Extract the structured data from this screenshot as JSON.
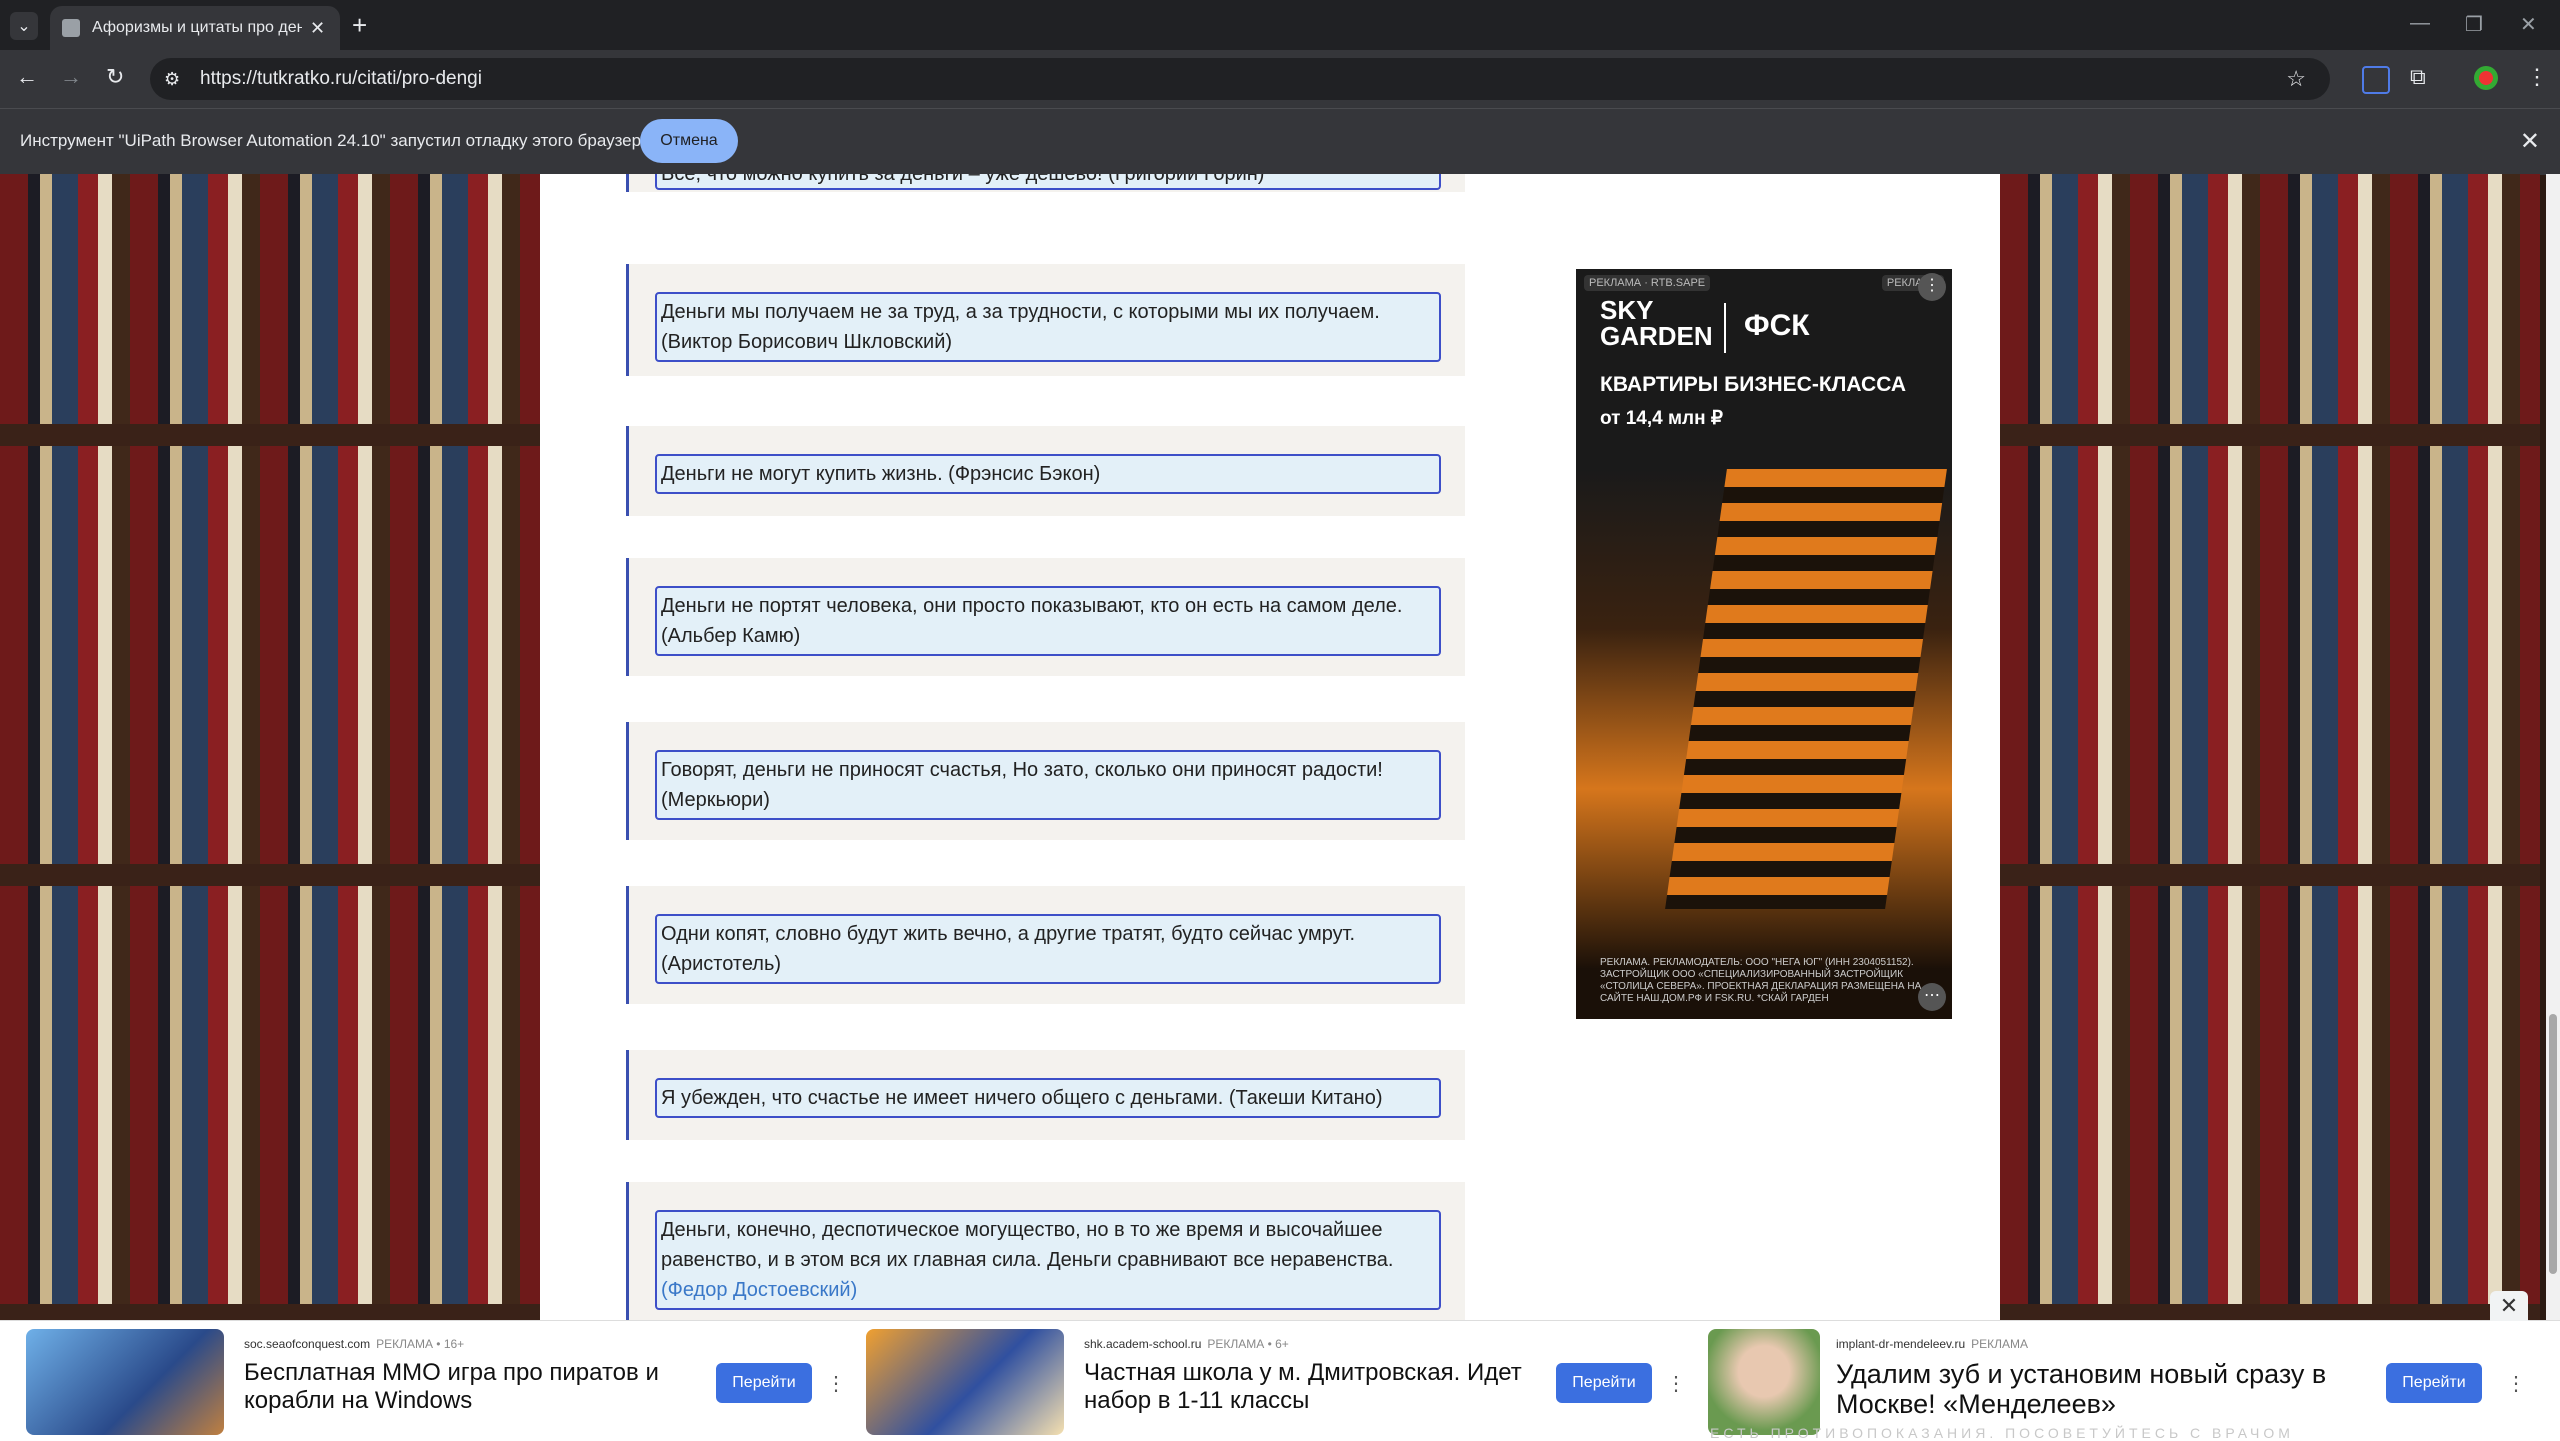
{
  "browser": {
    "tab_title": "Афоризмы и цитаты про день…",
    "url": "https://tutkratko.ru/citati/pro-dengi",
    "infobar_text": "Инструмент \"UiPath Browser Automation 24.10\" запустил отладку этого браузера.",
    "infobar_button": "Отмена"
  },
  "quotes": [
    {
      "text": "Все, что можно купить за деньги – уже дешево! (Григорий Горин)",
      "author_link": ""
    },
    {
      "text": "Деньги мы получаем не за труд, а за трудности, с которыми мы их получаем. (Виктор Борисович Шкловский)",
      "author_link": ""
    },
    {
      "text": "Деньги не могут купить жизнь. (Фрэнсис Бэкон)",
      "author_link": ""
    },
    {
      "text": "Деньги не портят человека, они просто показывают, кто он есть на самом деле. (Альбер Камю)",
      "author_link": ""
    },
    {
      "text": "Говорят, деньги не приносят счастья, Но зато, сколько они приносят радости! (Меркьюри)",
      "author_link": ""
    },
    {
      "text": "Одни копят, словно будут жить вечно, а другие тратят, будто сейчас умрут. (Аристотель)",
      "author_link": ""
    },
    {
      "text": "Я убежден, что счастье не имеет ничего общего с деньгами. (Такеши Китано)",
      "author_link": ""
    },
    {
      "text": "Деньги, конечно, деспотическое могущество, но в то же время и высочайшее равенство, и в этом вся их главная сила. Деньги сравнивают все неравенства.",
      "author_link": "(Федор Достоевский)"
    }
  ],
  "side_ad": {
    "label_left": "РЕКЛАМА · RTB.SAPE",
    "label_right": "РЕКЛАМА",
    "brand": "SKY GARDEN",
    "brand2": "ФСК",
    "headline": "КВАРТИРЫ БИЗНЕС-КЛАССА",
    "price": "от 14,4 млн ₽",
    "legal": "РЕКЛАМА. РЕКЛАМОДАТЕЛЬ: ООО \"НЕГА ЮГ\" (ИНН 2304051152). ЗАСТРОЙЩИК ООО «СПЕЦИАЛИЗИРОВАННЫЙ ЗАСТРОЙЩИК «СТОЛИЦА СЕВЕРА». ПРОЕКТНАЯ ДЕКЛАРАЦИЯ РАЗМЕЩЕНА НА САЙТЕ НАШ.ДОМ.РФ И FSK.RU. *СКАЙ ГАРДЕН"
  },
  "bottom_ads": [
    {
      "domain": "soc.seaofconquest.com",
      "label": "РЕКЛАМА • 16+",
      "title": "Бесплатная ММО игра про пиратов и корабли на Windows",
      "button": "Перейти"
    },
    {
      "domain": "shk.academ-school.ru",
      "label": "РЕКЛАМА • 6+",
      "title": "Частная школа у м. Дмитровская. Идет набор в 1-11 классы",
      "button": "Перейти"
    },
    {
      "domain": "implant-dr-mendeleev.ru",
      "label": "РЕКЛАМА",
      "title": "Удалим зуб и установим новый сразу в Москве! «Менделеев»",
      "button": "Перейти"
    }
  ],
  "bottom_warning": "ЕСТЬ ПРОТИВОПОКАЗАНИЯ. ПОСОВЕТУЙТЕСЬ С ВРАЧОМ",
  "colors": {
    "accent": "#3d4fc8",
    "quote_bg": "#e3f0f8",
    "link": "#3a78c8",
    "ad_button": "#3b6fe0"
  }
}
